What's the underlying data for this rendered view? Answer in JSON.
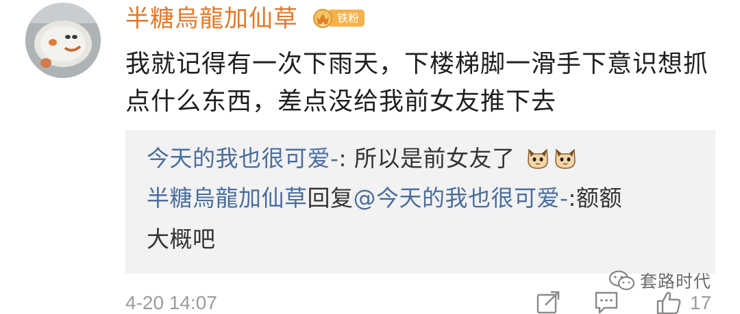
{
  "comment": {
    "username": "半糖烏龍加仙草",
    "fan_badge": "铁粉",
    "text": "我就记得有一次下雨天，下楼梯脚一滑手下意识想抓点什么东西，差点没给我前女友推下去",
    "timestamp": "4-20 14:07",
    "like_count": "17"
  },
  "replies": [
    {
      "author": "今天的我也很可爱-",
      "separator": ": ",
      "text": "所以是前女友了"
    },
    {
      "author": "半糖烏龍加仙草",
      "reply_word": "回复",
      "mention": "@今天的我也很可爱-",
      "text_line1": ":额额",
      "text_line2": "大概吧"
    }
  ],
  "watermark": {
    "text": "套路时代"
  },
  "colors": {
    "username": "#e0792b",
    "reply_author": "#4a6d9c",
    "meta_gray": "#9b9b9b",
    "reply_bg": "#f2f2f2",
    "badge_bg": "#f3b24c"
  },
  "icons": {
    "share": "share-icon",
    "comment": "comment-icon",
    "like": "thumbs-up-icon",
    "badge": "crown-icon",
    "watermark": "wechat-icon"
  }
}
